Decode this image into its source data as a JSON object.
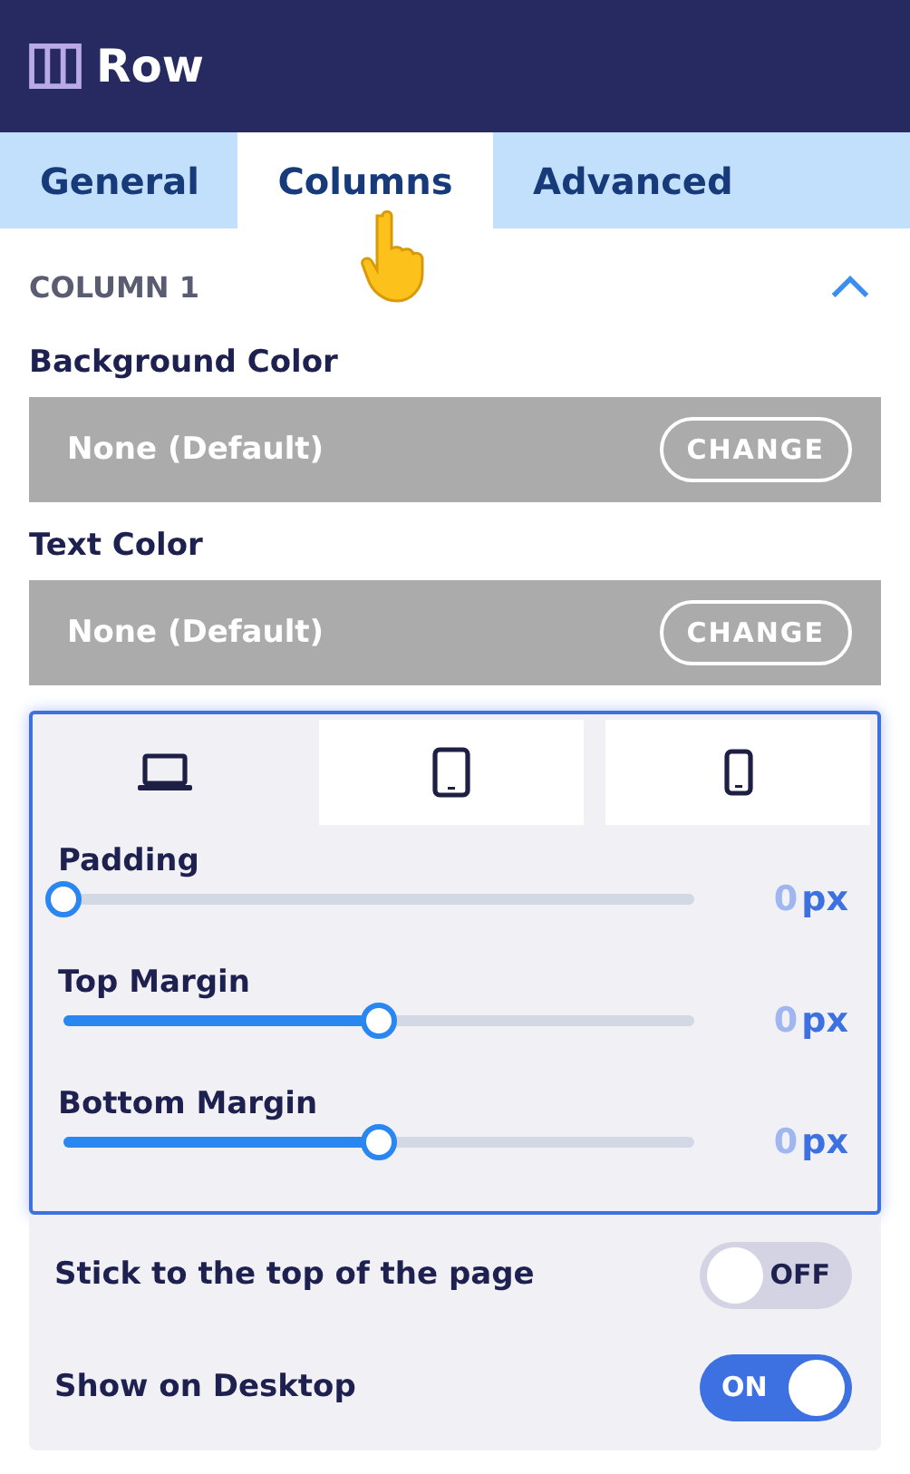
{
  "header": {
    "title": "Row"
  },
  "tabs": [
    {
      "label": "General",
      "selected": false
    },
    {
      "label": "Columns",
      "selected": true
    },
    {
      "label": "Advanced",
      "selected": false
    }
  ],
  "section": {
    "title": "COLUMN 1",
    "expanded": true
  },
  "color_fields": [
    {
      "label": "Background Color",
      "value": "None (Default)",
      "button": "CHANGE"
    },
    {
      "label": "Text Color",
      "value": "None (Default)",
      "button": "CHANGE"
    }
  ],
  "device_tabs": [
    {
      "kind": "laptop",
      "selected": true
    },
    {
      "kind": "tablet",
      "selected": false
    },
    {
      "kind": "phone",
      "selected": false
    }
  ],
  "sliders": [
    {
      "label": "Padding",
      "level": 0,
      "value": "0",
      "unit": "px"
    },
    {
      "label": "Top Margin",
      "level": 0.5,
      "value": "0",
      "unit": "px"
    },
    {
      "label": "Bottom Margin",
      "level": 0.5,
      "value": "0",
      "unit": "px"
    }
  ],
  "toggles": [
    {
      "label": "Stick to the top of the page",
      "on": false,
      "state": "OFF"
    },
    {
      "label": "Show on Desktop",
      "on": true,
      "state": "ON"
    }
  ]
}
